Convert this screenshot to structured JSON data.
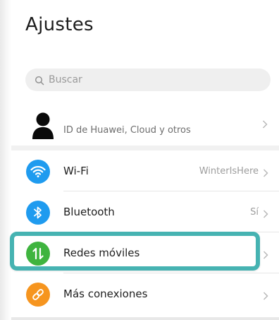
{
  "header": {
    "title": "Ajustes"
  },
  "search": {
    "placeholder": "Buscar"
  },
  "account": {
    "label": "ID de Huawei, Cloud y otros"
  },
  "settings": [
    {
      "label": "Wi-Fi",
      "value": "WinterIsHere",
      "icon": "wifi-icon",
      "color": "#1f9bef"
    },
    {
      "label": "Bluetooth",
      "value": "Sí",
      "icon": "bluetooth-icon",
      "color": "#1f9bef"
    },
    {
      "label": "Redes móviles",
      "value": "",
      "icon": "mobile-data-icon",
      "color": "#3fb43f",
      "highlighted": true
    },
    {
      "label": "Más conexiones",
      "value": "",
      "icon": "link-icon",
      "color": "#f6951f"
    }
  ],
  "colors": {
    "highlight": "#46b3b2"
  }
}
